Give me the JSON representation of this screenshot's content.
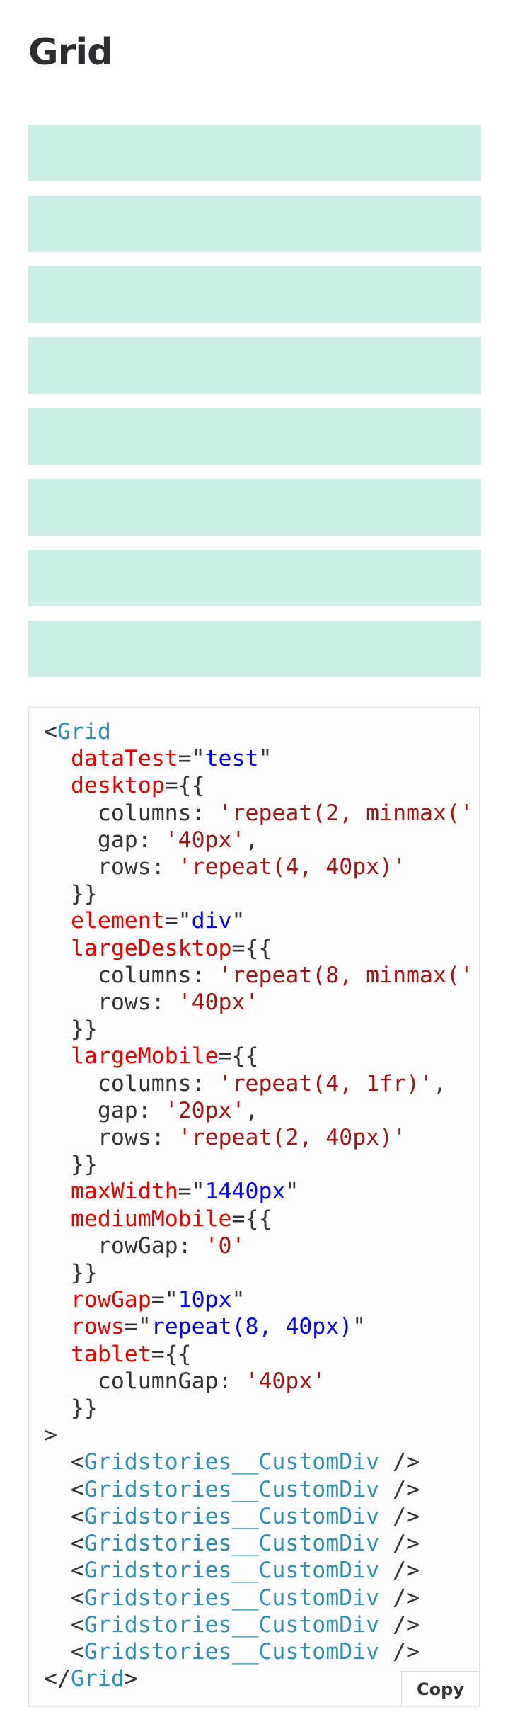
{
  "page": {
    "title": "Grid"
  },
  "grid_demo": {
    "cell_count": 8,
    "cell_color": "#cdeee6"
  },
  "code": {
    "lines": [
      [
        {
          "t": "p",
          "v": "<"
        },
        {
          "t": "tag",
          "v": "Grid"
        }
      ],
      [
        {
          "t": "p",
          "v": "  "
        },
        {
          "t": "attr",
          "v": "dataTest"
        },
        {
          "t": "p",
          "v": "=\""
        },
        {
          "t": "str",
          "v": "test"
        },
        {
          "t": "p",
          "v": "\""
        }
      ],
      [
        {
          "t": "p",
          "v": "  "
        },
        {
          "t": "attr",
          "v": "desktop"
        },
        {
          "t": "p",
          "v": "={{"
        }
      ],
      [
        {
          "t": "p",
          "v": "    columns: "
        },
        {
          "t": "lit",
          "v": "'repeat(2, minmax('"
        }
      ],
      [
        {
          "t": "p",
          "v": "    gap: "
        },
        {
          "t": "lit",
          "v": "'40px'"
        },
        {
          "t": "p",
          "v": ","
        }
      ],
      [
        {
          "t": "p",
          "v": "    rows: "
        },
        {
          "t": "lit",
          "v": "'repeat(4, 40px)'"
        }
      ],
      [
        {
          "t": "p",
          "v": "  }}"
        }
      ],
      [
        {
          "t": "p",
          "v": "  "
        },
        {
          "t": "attr",
          "v": "element"
        },
        {
          "t": "p",
          "v": "=\""
        },
        {
          "t": "str",
          "v": "div"
        },
        {
          "t": "p",
          "v": "\""
        }
      ],
      [
        {
          "t": "p",
          "v": "  "
        },
        {
          "t": "attr",
          "v": "largeDesktop"
        },
        {
          "t": "p",
          "v": "={{"
        }
      ],
      [
        {
          "t": "p",
          "v": "    columns: "
        },
        {
          "t": "lit",
          "v": "'repeat(8, minmax('"
        }
      ],
      [
        {
          "t": "p",
          "v": "    rows: "
        },
        {
          "t": "lit",
          "v": "'40px'"
        }
      ],
      [
        {
          "t": "p",
          "v": "  }}"
        }
      ],
      [
        {
          "t": "p",
          "v": "  "
        },
        {
          "t": "attr",
          "v": "largeMobile"
        },
        {
          "t": "p",
          "v": "={{"
        }
      ],
      [
        {
          "t": "p",
          "v": "    columns: "
        },
        {
          "t": "lit",
          "v": "'repeat(4, 1fr)'"
        },
        {
          "t": "p",
          "v": ","
        }
      ],
      [
        {
          "t": "p",
          "v": "    gap: "
        },
        {
          "t": "lit",
          "v": "'20px'"
        },
        {
          "t": "p",
          "v": ","
        }
      ],
      [
        {
          "t": "p",
          "v": "    rows: "
        },
        {
          "t": "lit",
          "v": "'repeat(2, 40px)'"
        }
      ],
      [
        {
          "t": "p",
          "v": "  }}"
        }
      ],
      [
        {
          "t": "p",
          "v": "  "
        },
        {
          "t": "attr",
          "v": "maxWidth"
        },
        {
          "t": "p",
          "v": "=\""
        },
        {
          "t": "str",
          "v": "1440px"
        },
        {
          "t": "p",
          "v": "\""
        }
      ],
      [
        {
          "t": "p",
          "v": "  "
        },
        {
          "t": "attr",
          "v": "mediumMobile"
        },
        {
          "t": "p",
          "v": "={{"
        }
      ],
      [
        {
          "t": "p",
          "v": "    rowGap: "
        },
        {
          "t": "lit",
          "v": "'0'"
        }
      ],
      [
        {
          "t": "p",
          "v": "  }}"
        }
      ],
      [
        {
          "t": "p",
          "v": "  "
        },
        {
          "t": "attr",
          "v": "rowGap"
        },
        {
          "t": "p",
          "v": "=\""
        },
        {
          "t": "str",
          "v": "10px"
        },
        {
          "t": "p",
          "v": "\""
        }
      ],
      [
        {
          "t": "p",
          "v": "  "
        },
        {
          "t": "attr",
          "v": "rows"
        },
        {
          "t": "p",
          "v": "=\""
        },
        {
          "t": "str",
          "v": "repeat(8, 40px)"
        },
        {
          "t": "p",
          "v": "\""
        }
      ],
      [
        {
          "t": "p",
          "v": "  "
        },
        {
          "t": "attr",
          "v": "tablet"
        },
        {
          "t": "p",
          "v": "={{"
        }
      ],
      [
        {
          "t": "p",
          "v": "    columnGap: "
        },
        {
          "t": "lit",
          "v": "'40px'"
        }
      ],
      [
        {
          "t": "p",
          "v": "  }}"
        }
      ],
      [
        {
          "t": "p",
          "v": ">"
        }
      ],
      [
        {
          "t": "p",
          "v": "  <"
        },
        {
          "t": "tag",
          "v": "Gridstories__CustomDiv"
        },
        {
          "t": "p",
          "v": " />"
        }
      ],
      [
        {
          "t": "p",
          "v": "  <"
        },
        {
          "t": "tag",
          "v": "Gridstories__CustomDiv"
        },
        {
          "t": "p",
          "v": " />"
        }
      ],
      [
        {
          "t": "p",
          "v": "  <"
        },
        {
          "t": "tag",
          "v": "Gridstories__CustomDiv"
        },
        {
          "t": "p",
          "v": " />"
        }
      ],
      [
        {
          "t": "p",
          "v": "  <"
        },
        {
          "t": "tag",
          "v": "Gridstories__CustomDiv"
        },
        {
          "t": "p",
          "v": " />"
        }
      ],
      [
        {
          "t": "p",
          "v": "  <"
        },
        {
          "t": "tag",
          "v": "Gridstories__CustomDiv"
        },
        {
          "t": "p",
          "v": " />"
        }
      ],
      [
        {
          "t": "p",
          "v": "  <"
        },
        {
          "t": "tag",
          "v": "Gridstories__CustomDiv"
        },
        {
          "t": "p",
          "v": " />"
        }
      ],
      [
        {
          "t": "p",
          "v": "  <"
        },
        {
          "t": "tag",
          "v": "Gridstories__CustomDiv"
        },
        {
          "t": "p",
          "v": " />"
        }
      ],
      [
        {
          "t": "p",
          "v": "  <"
        },
        {
          "t": "tag",
          "v": "Gridstories__CustomDiv"
        },
        {
          "t": "p",
          "v": " />"
        }
      ],
      [
        {
          "t": "p",
          "v": "</"
        },
        {
          "t": "tag",
          "v": "Grid"
        },
        {
          "t": "p",
          "v": ">"
        }
      ]
    ],
    "copy_label": "Copy"
  }
}
